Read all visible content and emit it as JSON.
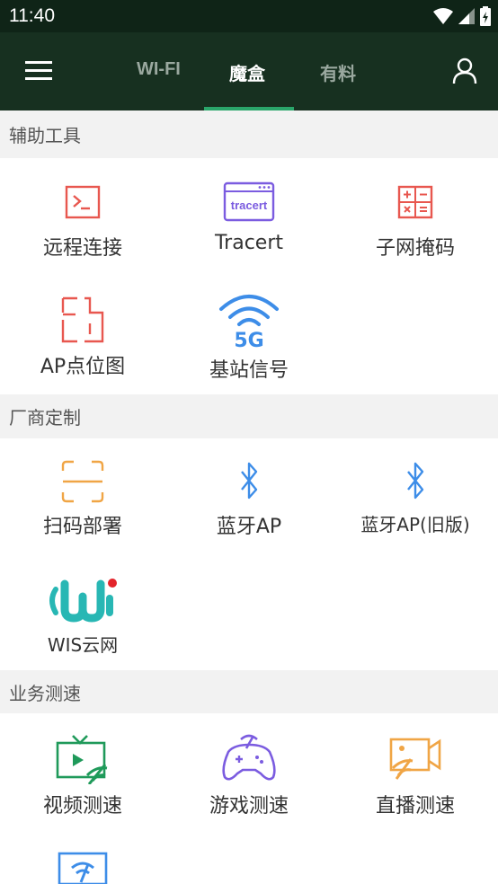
{
  "status_bar": {
    "time": "11:40"
  },
  "tabs": [
    {
      "label": "WI-FI",
      "active": false
    },
    {
      "label": "魔盒",
      "active": true
    },
    {
      "label": "有料",
      "active": false
    }
  ],
  "sections": [
    {
      "title": "辅助工具",
      "items": [
        {
          "label": "远程连接",
          "icon": "terminal-icon"
        },
        {
          "label": "Tracert",
          "icon": "tracert-icon",
          "icon_text": "tracert"
        },
        {
          "label": "子网掩码",
          "icon": "calculator-icon"
        },
        {
          "label": "AP点位图",
          "icon": "floorplan-icon"
        },
        {
          "label": "基站信号",
          "icon": "wifi-5g-icon",
          "icon_text": "5G"
        }
      ]
    },
    {
      "title": "厂商定制",
      "items": [
        {
          "label": "扫码部署",
          "icon": "scan-icon"
        },
        {
          "label": "蓝牙AP",
          "icon": "bluetooth-icon"
        },
        {
          "label": "蓝牙AP(旧版)",
          "icon": "bluetooth-icon"
        },
        {
          "label": "WIS云网",
          "icon": "wis-logo"
        }
      ]
    },
    {
      "title": "业务测速",
      "items": [
        {
          "label": "视频测速",
          "icon": "tv-speed-icon"
        },
        {
          "label": "游戏测速",
          "icon": "gamepad-speed-icon"
        },
        {
          "label": "直播测速",
          "icon": "camera-speed-icon"
        }
      ]
    }
  ],
  "colors": {
    "appbar": "#173020",
    "accent": "#2aa56a",
    "red": "#e8574f",
    "purple": "#7b5ce0",
    "blue": "#3d8de8",
    "orange": "#f0a545",
    "green": "#1f9a5a"
  }
}
